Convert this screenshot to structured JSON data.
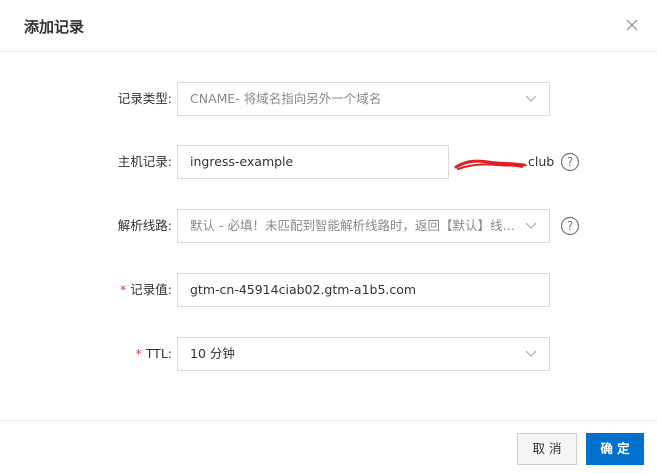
{
  "dialog": {
    "title": "添加记录",
    "close_icon": "close-icon"
  },
  "form": {
    "record_type": {
      "label": "记录类型:",
      "value": "CNAME- 将域名指向另外一个域名",
      "icon": "chevron-down-icon"
    },
    "host_record": {
      "label": "主机记录:",
      "value": "ingress-example",
      "suffix": ".club",
      "help_icon": "question-circle-icon"
    },
    "resolution_line": {
      "label": "解析线路:",
      "value": "默认 - 必填！未匹配到智能解析线路时，返回【默认】线路...",
      "icon": "chevron-down-icon",
      "help_icon": "question-circle-icon"
    },
    "record_value": {
      "required_mark": "*",
      "label": "记录值:",
      "value": "gtm-cn-45914ciab02.gtm-a1b5.com"
    },
    "ttl": {
      "required_mark": "*",
      "label": "TTL:",
      "value": "10 分钟",
      "icon": "chevron-down-icon"
    }
  },
  "footer": {
    "cancel_label": "取 消",
    "confirm_label": "确 定"
  },
  "colors": {
    "primary": "#0070cc",
    "required": "#e4393c",
    "redaction": "#e02020"
  }
}
